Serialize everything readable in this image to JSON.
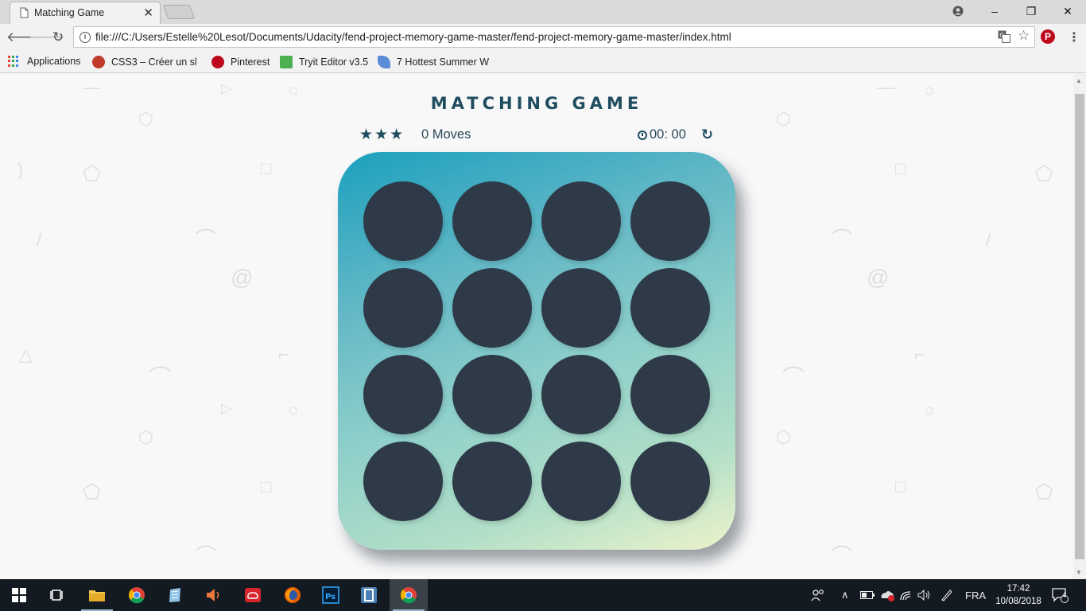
{
  "browser": {
    "tab_title": "Matching Game",
    "tab_close": "✕",
    "url": "file:///C:/Users/Estelle%20Lesot/Documents/Udacity/fend-project-memory-game-master/fend-project-memory-game-master/index.html",
    "window_buttons": {
      "minimize": "–",
      "restore": "❐",
      "close": "✕"
    },
    "bookmarks": [
      {
        "label": "Applications",
        "icon": "apps-grid-icon"
      },
      {
        "label": "CSS3 – Créer un slid",
        "icon": "css3-favicon",
        "color": "#c0392b"
      },
      {
        "label": "Pinterest",
        "icon": "pinterest-icon",
        "color": "#bd081c"
      },
      {
        "label": "Tryit Editor v3.5",
        "icon": "w3schools-icon",
        "color": "#4caf50"
      },
      {
        "label": "7 Hottest Summer W",
        "icon": "bird-icon",
        "color": "#5b8ad6"
      }
    ]
  },
  "game": {
    "title": "MATCHING GAME",
    "stars": [
      "★",
      "★",
      "★"
    ],
    "moves": "0 Moves",
    "timer": "00: 00",
    "restart_icon": "↻",
    "card_color": "#2e3a48",
    "card_count": 16
  },
  "taskbar": {
    "language": "FRA",
    "time": "17:42",
    "date": "10/08/2018",
    "notifications": "4",
    "apps": [
      "start-icon",
      "task-view-icon",
      "file-explorer-icon",
      "chrome-icon",
      "notepad-icon",
      "speaker-app-icon",
      "creative-cloud-icon",
      "firefox-icon",
      "photoshop-icon",
      "app-icon",
      "chrome-icon"
    ]
  }
}
